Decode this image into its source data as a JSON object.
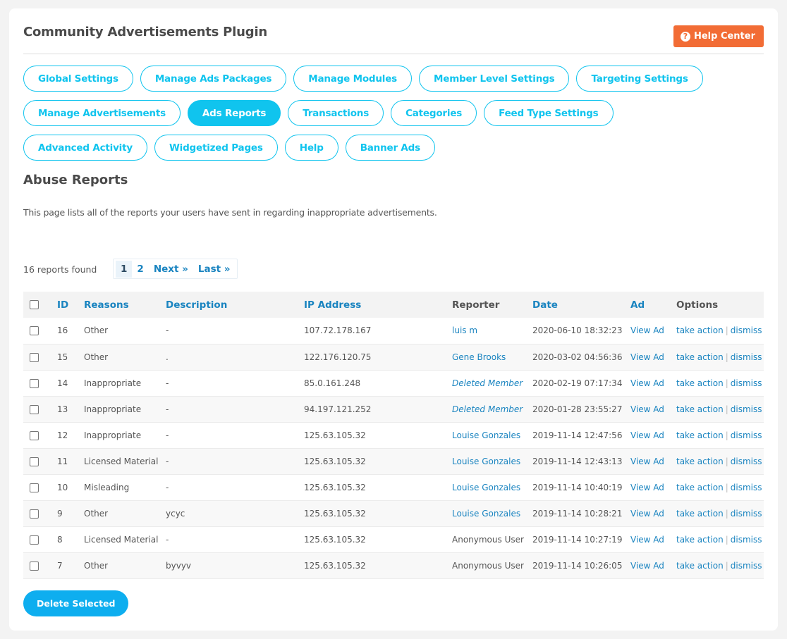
{
  "header": {
    "title": "Community Advertisements Plugin",
    "help_center_label": "Help Center",
    "help_icon": "question-circle-icon"
  },
  "tabs": [
    {
      "label": "Global Settings",
      "active": false
    },
    {
      "label": "Manage Ads Packages",
      "active": false
    },
    {
      "label": "Manage Modules",
      "active": false
    },
    {
      "label": "Member Level Settings",
      "active": false
    },
    {
      "label": "Targeting Settings",
      "active": false
    },
    {
      "label": "Manage Advertisements",
      "active": false
    },
    {
      "label": "Ads Reports",
      "active": true
    },
    {
      "label": "Transactions",
      "active": false
    },
    {
      "label": "Categories",
      "active": false
    },
    {
      "label": "Feed Type Settings",
      "active": false
    },
    {
      "label": "Advanced Activity",
      "active": false
    },
    {
      "label": "Widgetized Pages",
      "active": false
    },
    {
      "label": "Help",
      "active": false
    },
    {
      "label": "Banner Ads",
      "active": false
    }
  ],
  "section": {
    "title": "Abuse Reports",
    "description": "This page lists all of the reports your users have sent in regarding inappropriate advertisements."
  },
  "pagination": {
    "count_label": "16 reports found",
    "pages": [
      "1",
      "2"
    ],
    "current": "1",
    "next_label": "Next »",
    "last_label": "Last »"
  },
  "table": {
    "headers": {
      "id": "ID",
      "reasons": "Reasons",
      "description": "Description",
      "ip": "IP Address",
      "reporter": "Reporter",
      "date": "Date",
      "ad": "Ad",
      "options": "Options"
    },
    "view_ad_label": "View Ad",
    "take_action_label": "take action",
    "dismiss_label": "dismiss",
    "separator": "|",
    "rows": [
      {
        "id": "16",
        "reason": "Other",
        "description": "-",
        "ip": "107.72.178.167",
        "reporter": "luis m",
        "reporter_type": "link",
        "date": "2020-06-10 18:32:23"
      },
      {
        "id": "15",
        "reason": "Other",
        "description": ".",
        "ip": "122.176.120.75",
        "reporter": "Gene Brooks",
        "reporter_type": "link",
        "date": "2020-03-02 04:56:36"
      },
      {
        "id": "14",
        "reason": "Inappropriate",
        "description": "-",
        "ip": "85.0.161.248",
        "reporter": "Deleted Member",
        "reporter_type": "deleted",
        "date": "2020-02-19 07:17:34"
      },
      {
        "id": "13",
        "reason": "Inappropriate",
        "description": "-",
        "ip": "94.197.121.252",
        "reporter": "Deleted Member",
        "reporter_type": "deleted",
        "date": "2020-01-28 23:55:27"
      },
      {
        "id": "12",
        "reason": "Inappropriate",
        "description": "-",
        "ip": "125.63.105.32",
        "reporter": "Louise Gonzales",
        "reporter_type": "link",
        "date": "2019-11-14 12:47:56"
      },
      {
        "id": "11",
        "reason": "Licensed Material",
        "description": "-",
        "ip": "125.63.105.32",
        "reporter": "Louise Gonzales",
        "reporter_type": "link",
        "date": "2019-11-14 12:43:13"
      },
      {
        "id": "10",
        "reason": "Misleading",
        "description": "-",
        "ip": "125.63.105.32",
        "reporter": "Louise Gonzales",
        "reporter_type": "link",
        "date": "2019-11-14 10:40:19"
      },
      {
        "id": "9",
        "reason": "Other",
        "description": "ycyc",
        "ip": "125.63.105.32",
        "reporter": "Louise Gonzales",
        "reporter_type": "link",
        "date": "2019-11-14 10:28:21"
      },
      {
        "id": "8",
        "reason": "Licensed Material",
        "description": "-",
        "ip": "125.63.105.32",
        "reporter": "Anonymous User",
        "reporter_type": "text",
        "date": "2019-11-14 10:27:19"
      },
      {
        "id": "7",
        "reason": "Other",
        "description": "byvyv",
        "ip": "125.63.105.32",
        "reporter": "Anonymous User",
        "reporter_type": "text",
        "date": "2019-11-14 10:26:05"
      }
    ]
  },
  "footer": {
    "delete_selected_label": "Delete Selected"
  },
  "colors": {
    "accent": "#10c4ee",
    "link": "#1a84c0",
    "help_button": "#f26c35",
    "delete_button": "#0eaeef"
  }
}
